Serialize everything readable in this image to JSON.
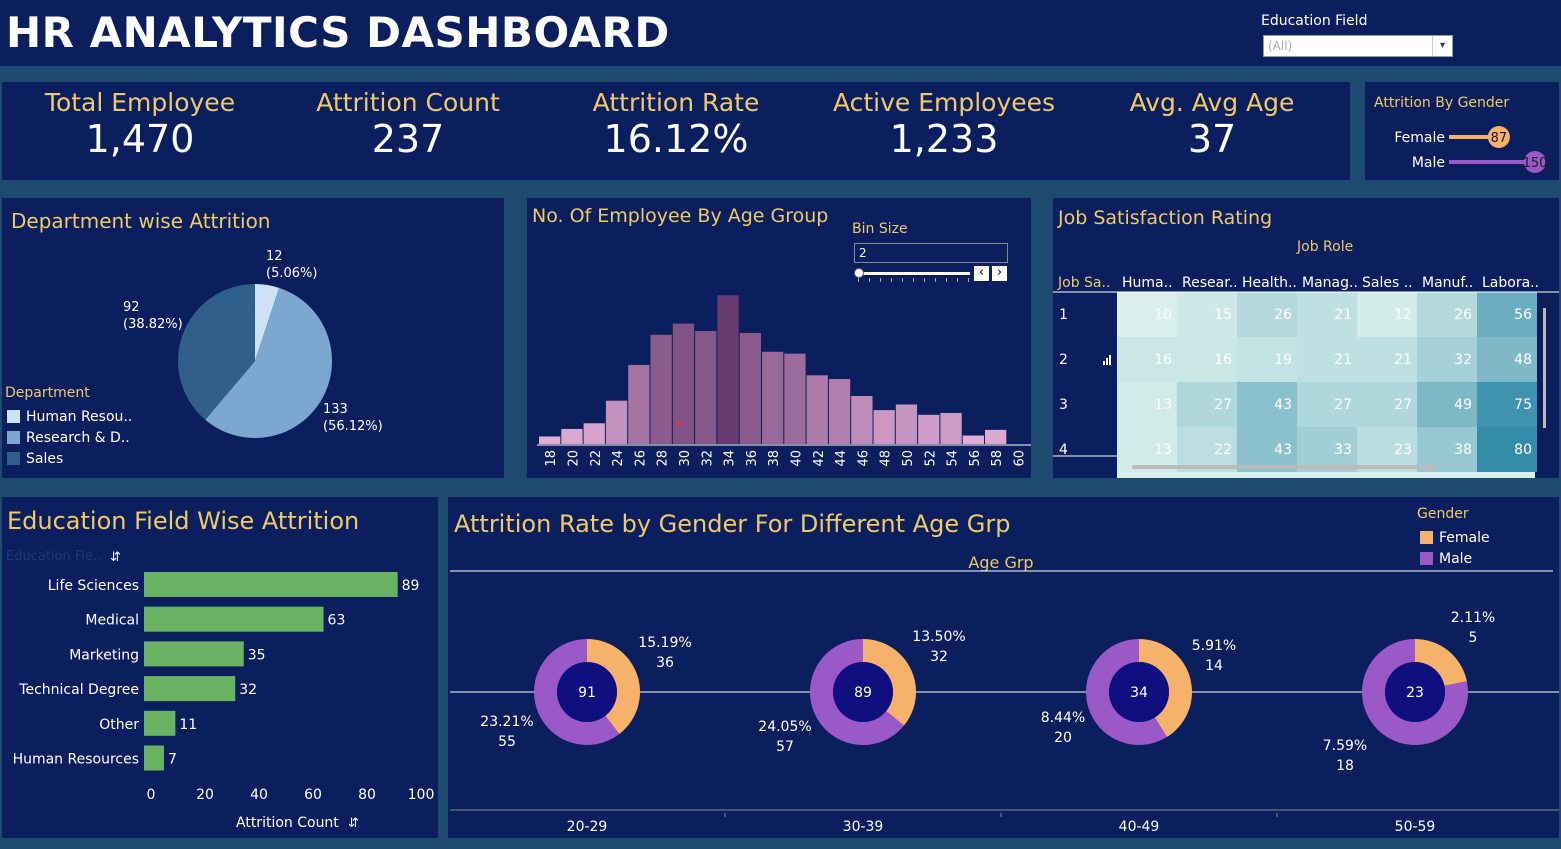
{
  "header": {
    "title": "HR ANALYTICS DASHBOARD",
    "filter_label": "Education Field",
    "filter_value": "(All)"
  },
  "kpis": [
    {
      "label": "Total Employee",
      "value": "1,470"
    },
    {
      "label": "Attrition Count",
      "value": "237"
    },
    {
      "label": "Attrition Rate",
      "value": "16.12%"
    },
    {
      "label": "Active Employees",
      "value": "1,233"
    },
    {
      "label": "Avg. Avg Age",
      "value": "37"
    }
  ],
  "gender_attrition": {
    "title": "Attrition By Gender",
    "max": 150,
    "rows": [
      {
        "label": "Female",
        "value": 87,
        "color": "#f6b26b"
      },
      {
        "label": "Male",
        "value": 150,
        "color": "#9b59c8"
      }
    ]
  },
  "dept": {
    "title": "Department wise Attrition",
    "legend_title": "Department",
    "legend": [
      {
        "label": "Human Resou..",
        "color": "#cfe2f3"
      },
      {
        "label": "Research & D..",
        "color": "#7ba7d0"
      },
      {
        "label": "Sales",
        "color": "#2f5f8a"
      }
    ],
    "labels": [
      {
        "count": "12",
        "pct": "(5.06%)"
      },
      {
        "count": "133",
        "pct": "(56.12%)"
      },
      {
        "count": "92",
        "pct": "(38.82%)"
      }
    ]
  },
  "age": {
    "title": "No. Of Employee By Age Group",
    "bin_label": "Bin Size",
    "bin_value": "2",
    "prev_icon": "‹",
    "next_icon": "›"
  },
  "job": {
    "title": "Job Satisfaction Rating",
    "col_header": "Job Role",
    "row_header": "Job Sa..",
    "columns": [
      "Huma..",
      "Resear..",
      "Health..",
      "Manag..",
      "Sales ..",
      "Manuf..",
      "Labora.."
    ],
    "rows": [
      {
        "label": "1",
        "values": [
          10,
          15,
          26,
          21,
          12,
          26,
          56
        ]
      },
      {
        "label": "2",
        "values": [
          16,
          16,
          19,
          21,
          21,
          32,
          48
        ]
      },
      {
        "label": "3",
        "values": [
          13,
          27,
          43,
          27,
          27,
          49,
          75
        ]
      },
      {
        "label": "4",
        "values": [
          13,
          22,
          43,
          33,
          23,
          38,
          80
        ]
      }
    ]
  },
  "edu": {
    "title": "Education Field Wise Attrition",
    "field_header": "Education Fie..",
    "x_label": "Attrition Count"
  },
  "gender_age": {
    "title": "Attrition Rate by Gender For Different Age Grp",
    "axis_title": "Age Grp",
    "legend_title": "Gender",
    "legend": [
      {
        "label": "Female",
        "color": "#f6b26b"
      },
      {
        "label": "Male",
        "color": "#9b59c8"
      }
    ],
    "groups": [
      {
        "label": "20-29",
        "total": "91",
        "female_pct": "15.19%",
        "female": 36,
        "male_pct": "23.21%",
        "male": 55
      },
      {
        "label": "30-39",
        "total": "89",
        "female_pct": "13.50%",
        "female": 32,
        "male_pct": "24.05%",
        "male": 57
      },
      {
        "label": "40-49",
        "total": "34",
        "female_pct": "5.91%",
        "female": 14,
        "male_pct": "8.44%",
        "male": 20
      },
      {
        "label": "50-59",
        "total": "23",
        "female_pct": "2.11%",
        "female": 5,
        "male_pct": "7.59%",
        "male": 18
      }
    ]
  },
  "chart_data": [
    {
      "type": "pie",
      "title": "Department wise Attrition",
      "categories": [
        "Human Resources",
        "Research & Development",
        "Sales"
      ],
      "values": [
        12,
        133,
        92
      ],
      "percents": [
        5.06,
        56.12,
        38.82
      ],
      "legend": "left"
    },
    {
      "type": "bar",
      "title": "No. Of Employee By Age Group",
      "categories": [
        "18",
        "20",
        "22",
        "24",
        "26",
        "28",
        "30",
        "32",
        "34",
        "36",
        "38",
        "40",
        "42",
        "44",
        "46",
        "48",
        "50",
        "52",
        "54",
        "56",
        "58",
        "60"
      ],
      "values": [
        8,
        16,
        22,
        46,
        84,
        116,
        128,
        120,
        158,
        118,
        98,
        96,
        73,
        69,
        51,
        36,
        42,
        31,
        33,
        9,
        15,
        0
      ],
      "ylim": [
        0,
        170
      ]
    },
    {
      "type": "heatmap",
      "title": "Job Satisfaction Rating",
      "x": [
        "Huma..",
        "Resear..",
        "Health..",
        "Manag..",
        "Sales ..",
        "Manuf..",
        "Labora.."
      ],
      "y": [
        "1",
        "2",
        "3",
        "4"
      ],
      "values": [
        [
          10,
          15,
          26,
          21,
          12,
          26,
          56
        ],
        [
          16,
          16,
          19,
          21,
          21,
          32,
          48
        ],
        [
          13,
          27,
          43,
          27,
          27,
          49,
          75
        ],
        [
          13,
          22,
          43,
          33,
          23,
          38,
          80
        ]
      ]
    },
    {
      "type": "bar",
      "title": "Education Field Wise Attrition",
      "orientation": "horizontal",
      "categories": [
        "Life Sciences",
        "Medical",
        "Marketing",
        "Technical Degree",
        "Other",
        "Human Resources"
      ],
      "values": [
        89,
        63,
        35,
        32,
        11,
        7
      ],
      "xlim": [
        0,
        100
      ],
      "xticks": [
        0,
        20,
        40,
        60,
        80,
        100
      ],
      "xlabel": "Attrition Count",
      "color": "#6ab364"
    },
    {
      "type": "pie",
      "title": "Attrition Rate by Gender For Different Age Grp",
      "categories": [
        "20-29",
        "30-39",
        "40-49",
        "50-59"
      ],
      "series": [
        {
          "name": "Female",
          "values": [
            36,
            32,
            14,
            5
          ]
        },
        {
          "name": "Male",
          "values": [
            55,
            57,
            20,
            18
          ]
        }
      ],
      "xlabel": "Age Grp",
      "legend": "top-right"
    }
  ]
}
